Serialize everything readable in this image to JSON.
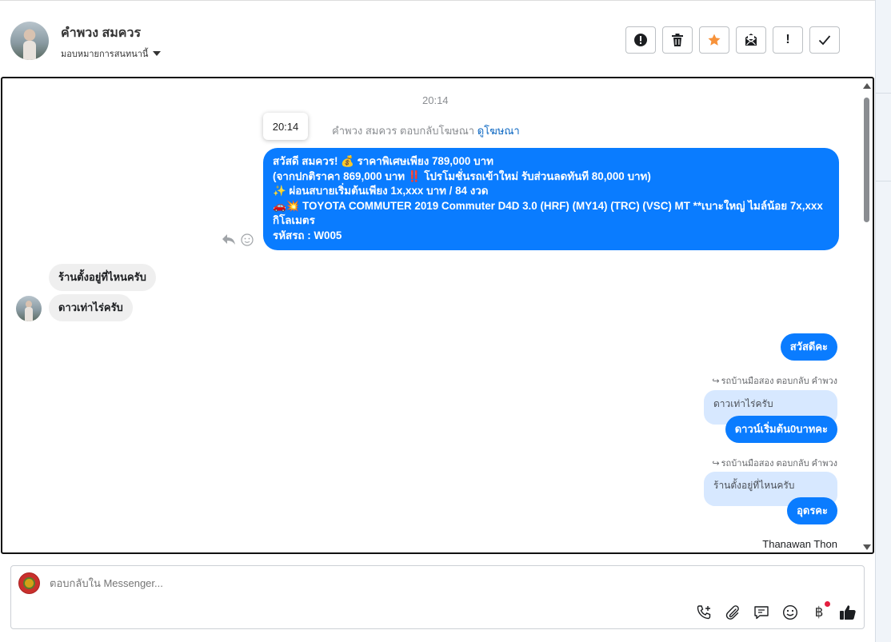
{
  "header": {
    "contact_name": "คำพวง สมควร",
    "assign_label": "มอบหมายการสนทนานี้",
    "actions": [
      {
        "icon": "alert-circle-icon"
      },
      {
        "icon": "trash-icon"
      },
      {
        "icon": "star-icon",
        "color": "#f7923a"
      },
      {
        "icon": "mark-unread-icon"
      },
      {
        "icon": "exclamation-icon",
        "label": "!"
      },
      {
        "icon": "check-icon"
      }
    ]
  },
  "chat": {
    "date_time": "20:14",
    "tooltip_time": "20:14",
    "ad_reply": {
      "text": "คำพวง สมควร ตอบกลับโฆษณา",
      "link": "ดูโฆษณา"
    },
    "ad_message": {
      "lines": [
        "สวัสดี สมควร! 💰 ราคาพิเศษเพียง 789,000 บาท",
        "(จากปกติราคา 869,000 บาท ‼️ โปรโมชั่นรถเข้าใหม่ รับส่วนลดทันที 80,000 บาท)",
        "✨ ผ่อนสบายเริ่มต้นเพียง 1x,xxx บาท / 84 งวด",
        "🚗💥 TOYOTA COMMUTER 2019 Commuter D4D 3.0 (HRF) (MY14) (TRC) (VSC) MT **เบาะใหญ่ ไมล์น้อย 7x,xxx",
        "กิโลเมตร",
        " รหัสรถ : W005"
      ]
    },
    "incoming": [
      "ร้านตั้งอยู่ที่ไหนครับ",
      "ดาวเท่าไร่ครับ"
    ],
    "outgoing_1": "สวัสดีคะ",
    "reply_1": {
      "meta": "รถบ้านมือสอง ตอบกลับ คำพวง",
      "quoted": "ดาวเท่าไร่ครับ",
      "message": "ดาวน์เริ่มต้น0บาทคะ"
    },
    "reply_2": {
      "meta": "รถบ้านมือสอง ตอบกลับ คำพวง",
      "quoted": "ร้านตั้งอยู่ที่ไหนครับ",
      "message": "อุดรคะ"
    },
    "sender_name": "Thanawan Thon",
    "bubble_color": "#0a7cff"
  },
  "composer": {
    "placeholder": "ตอบกลับใน Messenger...",
    "tools": [
      "phone-plus-icon",
      "paperclip-icon",
      "saved-reply-icon",
      "emoji-icon",
      "baht-icon",
      "thumbs-up-icon"
    ],
    "baht_symbol": "฿"
  }
}
